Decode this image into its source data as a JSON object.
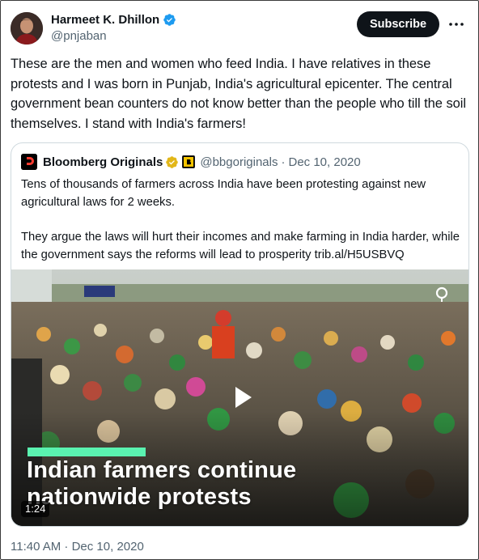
{
  "author": {
    "display_name": "Harmeet K. Dhillon",
    "handle": "@pnjaban",
    "verified_icon": "blue-verified-badge",
    "avatar_icon": "profile-photo"
  },
  "actions": {
    "subscribe_label": "Subscribe",
    "more_icon": "more-dots-icon"
  },
  "tweet": {
    "text": "These are the men and women who feed India. I have relatives in these protests and I was born in Punjab, India's agricultural epicenter. The central government bean counters do not know better than the people who till the soil themselves. I stand with India's farmers!",
    "timestamp": "11:40 AM · Dec 10, 2020"
  },
  "quote": {
    "name": "Bloomberg Originals",
    "handle": "@bbgoriginals",
    "separator": "·",
    "date": "Dec 10, 2020",
    "paragraph_1": "Tens of thousands of farmers across India have been protesting against new agricultural laws for 2 weeks.",
    "paragraph_2": "They argue the laws will hurt their incomes and make farming in India harder, while the government says the reforms will lead to prosperity trib.al/H5USBVQ",
    "badges": [
      "gold-verified-badge",
      "affiliate-badge"
    ]
  },
  "video": {
    "headline_line_1": "Indian farmers continue",
    "headline_line_2": "nationwide protests",
    "duration": "1:24",
    "accent_color": "#5af2b0"
  }
}
